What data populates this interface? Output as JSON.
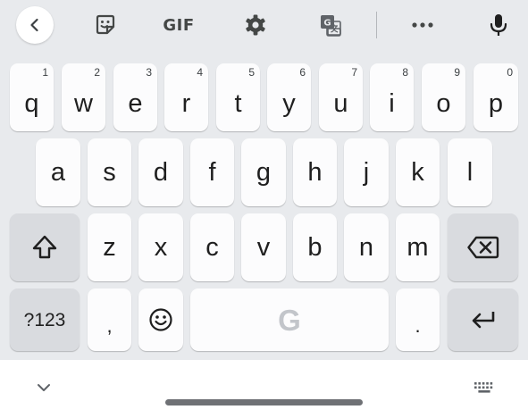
{
  "toolbar": {
    "gif_label": "GIF",
    "items": [
      "back-icon",
      "sticker-icon",
      "gif",
      "gear-icon",
      "translate-icon",
      "more-icon",
      "microphone-icon"
    ]
  },
  "rows": {
    "row1": [
      {
        "label": "q",
        "hint": "1"
      },
      {
        "label": "w",
        "hint": "2"
      },
      {
        "label": "e",
        "hint": "3"
      },
      {
        "label": "r",
        "hint": "4"
      },
      {
        "label": "t",
        "hint": "5"
      },
      {
        "label": "y",
        "hint": "6"
      },
      {
        "label": "u",
        "hint": "7"
      },
      {
        "label": "i",
        "hint": "8"
      },
      {
        "label": "o",
        "hint": "9"
      },
      {
        "label": "p",
        "hint": "0"
      }
    ],
    "row2": [
      "a",
      "s",
      "d",
      "f",
      "g",
      "h",
      "j",
      "k",
      "l"
    ],
    "row3": [
      "z",
      "x",
      "c",
      "v",
      "b",
      "n",
      "m"
    ],
    "row4": {
      "symbols": "?123",
      "comma": ",",
      "space_logo": "G",
      "period": "."
    }
  },
  "colors": {
    "keyboard_bg": "#e8eaed",
    "key_bg": "#fcfcfd",
    "special_key_bg": "#d9dbdf",
    "text": "#1f1f1f"
  },
  "bottom": {
    "left_icon": "chevron-down-icon",
    "right_icon": "keyboard-icon"
  }
}
